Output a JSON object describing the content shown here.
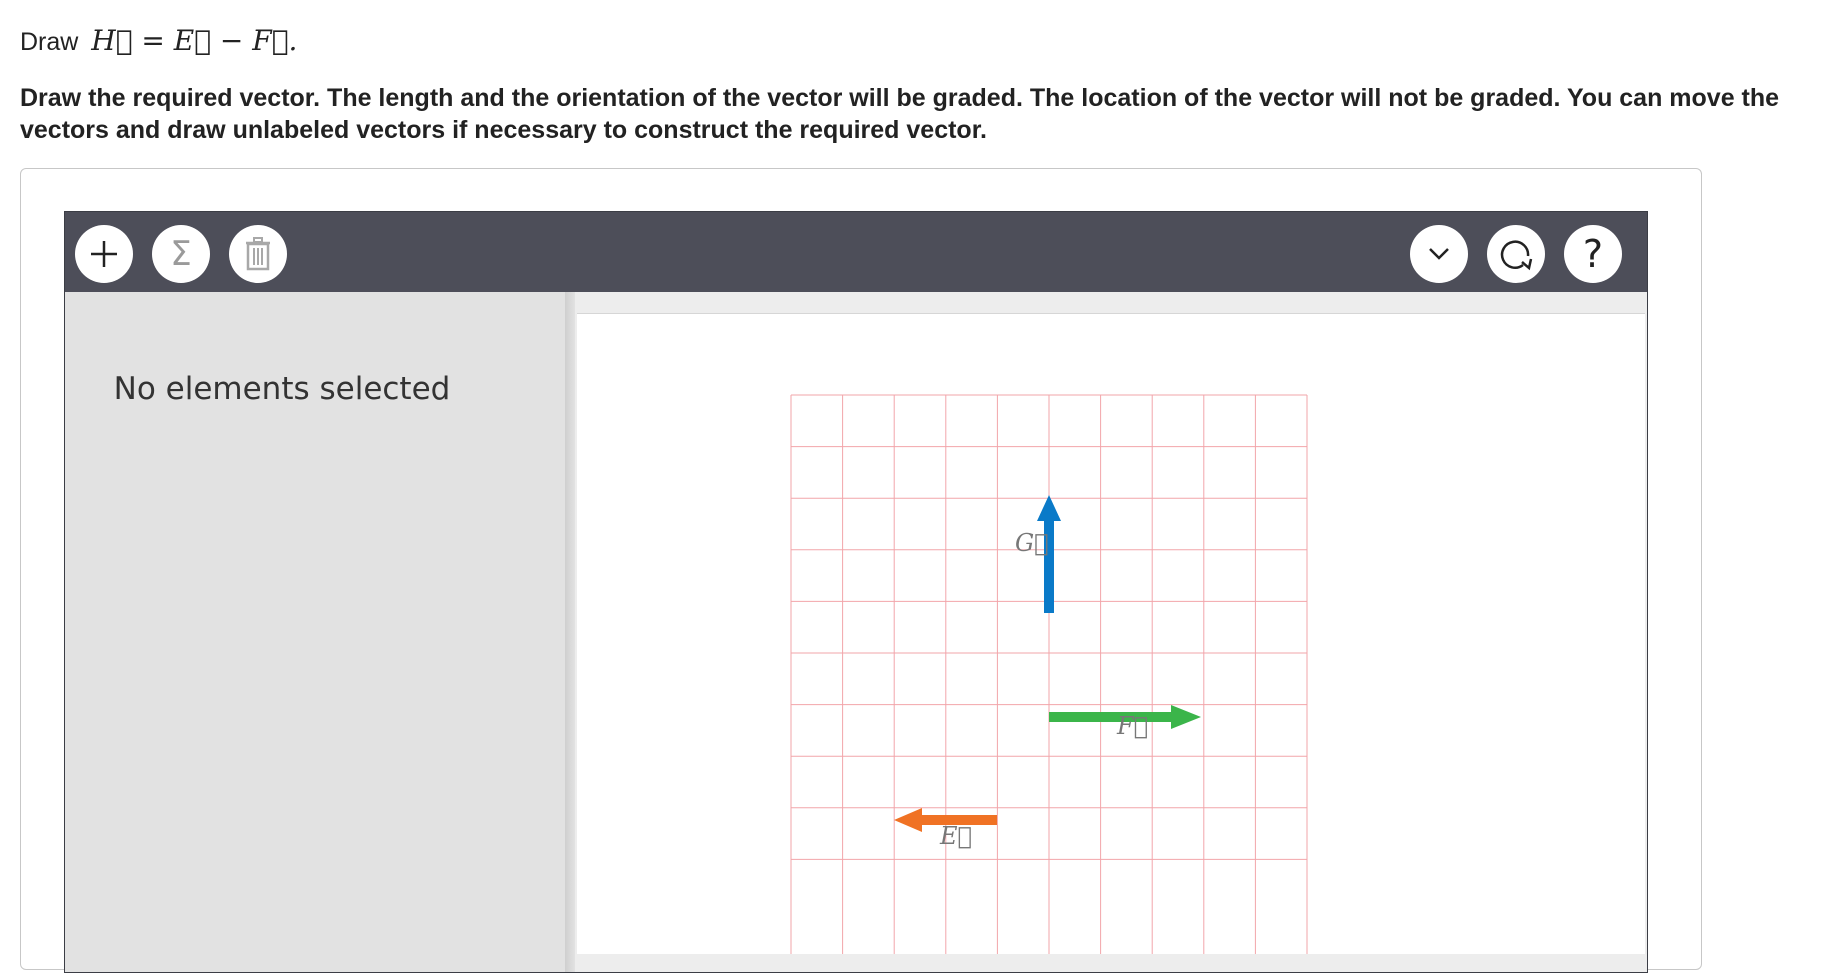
{
  "prompt": {
    "word": "Draw",
    "equation": "H⃗ = E⃗ − F⃗."
  },
  "instructions": "Draw the required vector. The length and the orientation of the vector will be graded. The location of the vector will not be graded. You can move the vectors and draw unlabeled vectors if necessary to construct the required vector.",
  "toolbar": {
    "left_buttons": [
      "plus-icon",
      "sigma-icon",
      "trash-icon"
    ],
    "right_buttons": [
      "chevron-down-icon",
      "reset-icon",
      "help-icon"
    ],
    "help_glyph": "?",
    "sigma_glyph": "Σ"
  },
  "side_panel": {
    "status": "No elements selected"
  },
  "grid": {
    "columns": 10,
    "rows_visible": 9,
    "line_color": "#f2a5aa"
  },
  "vectors": [
    {
      "label": "G⃗",
      "color": "#0a7ac8",
      "direction": "up",
      "length_units": 2
    },
    {
      "label": "F⃗",
      "color": "#3bb54a",
      "direction": "right",
      "length_units": 3
    },
    {
      "label": "E⃗",
      "color": "#f07224",
      "direction": "left",
      "length_units": 2
    }
  ],
  "colors": {
    "toolbar": "#4d4e59",
    "side_panel": "#e2e2e2",
    "vector_g": "#0a7ac8",
    "vector_f": "#3bb54a",
    "vector_e": "#f07224"
  }
}
